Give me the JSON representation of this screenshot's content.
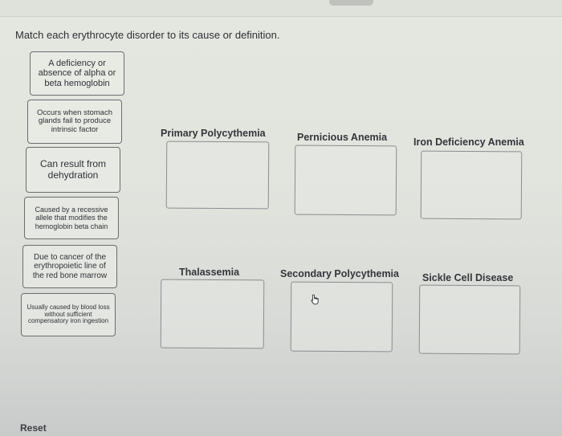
{
  "instruction": "Match each erythrocyte disorder to its cause or definition.",
  "answer_cards": [
    {
      "text": "A deficiency or absence of alpha or beta hemoglobin"
    },
    {
      "text": "Occurs when stomach glands fail to produce intrinsic factor"
    },
    {
      "text": "Can result from dehydration"
    },
    {
      "text": "Caused by a recessive allele that modifies the hemoglobin beta chain"
    },
    {
      "text": "Due to cancer of the erythropoietic line of the red bone marrow"
    },
    {
      "text": "Usually caused by blood loss without sufficient compensatory iron ingestion"
    }
  ],
  "targets": [
    {
      "label": "Primary Polycythemia",
      "value": ""
    },
    {
      "label": "Pernicious Anemia",
      "value": ""
    },
    {
      "label": "Iron Deficiency Anemia",
      "value": ""
    },
    {
      "label": "Thalassemia",
      "value": ""
    },
    {
      "label": "Secondary Polycythemia",
      "value": ""
    },
    {
      "label": "Sickle Cell Disease",
      "value": ""
    }
  ],
  "cursor": {
    "icon": "hand-pointer-icon"
  },
  "reset_label": "Reset"
}
